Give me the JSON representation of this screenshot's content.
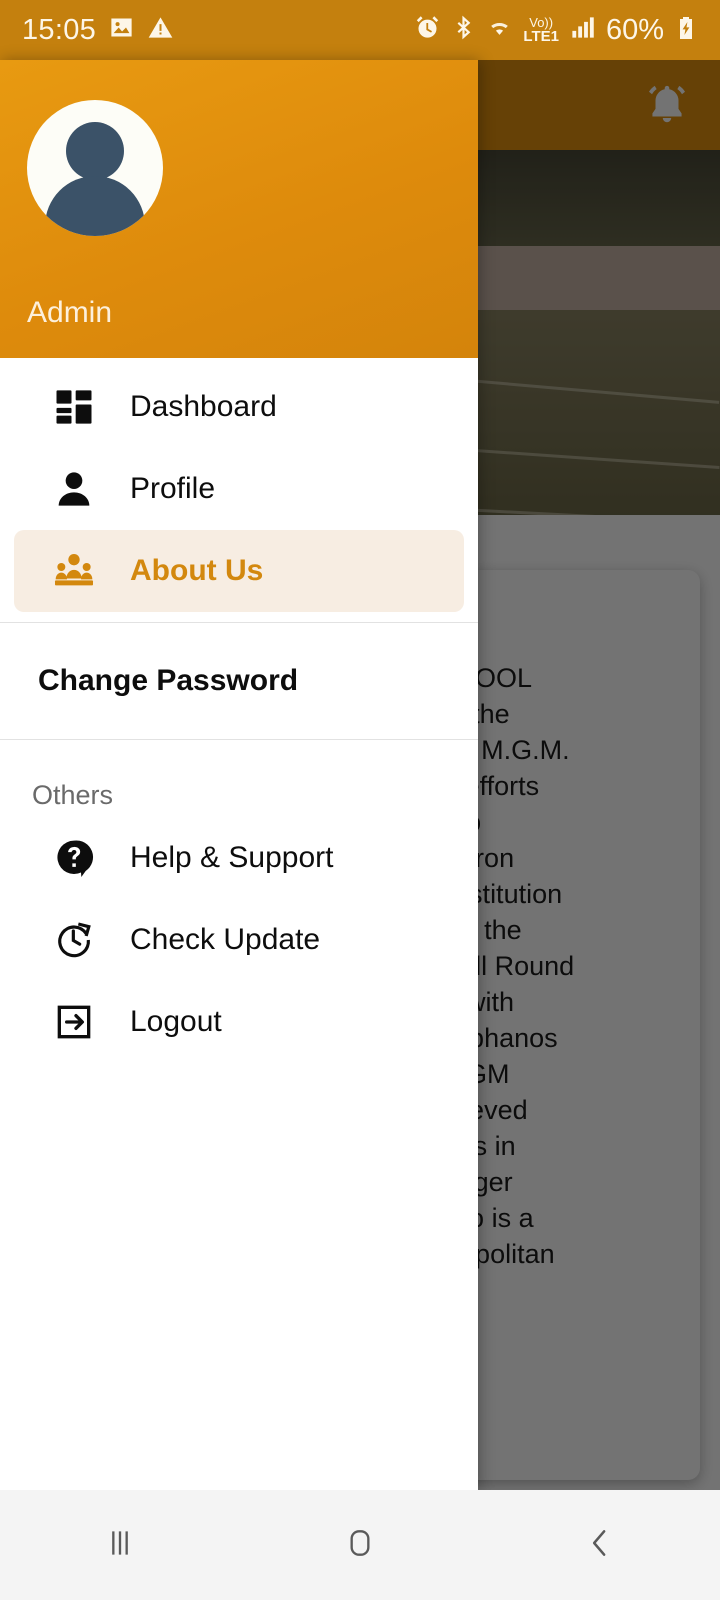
{
  "status_bar": {
    "time": "15:05",
    "battery_percent": "60%",
    "volte_top": "Vo))",
    "volte_bottom": "LTE1",
    "icons": [
      "gallery-icon",
      "warning-icon",
      "alarm-icon",
      "bluetooth-icon",
      "wifi-icon",
      "volte-icon",
      "signal-icon",
      "battery-charging-icon"
    ],
    "background_color": "#C4800E"
  },
  "app_bar": {
    "notification_icon": "bell-icon",
    "background_color": "#E2900F"
  },
  "drawer": {
    "username": "Admin",
    "header_color": "#DE8B0C",
    "accent_color": "#D3880E",
    "active_row_color": "#F7EDE2",
    "items": [
      {
        "label": "Dashboard",
        "icon": "dashboard-icon",
        "active": false
      },
      {
        "label": "Profile",
        "icon": "person-icon",
        "active": false
      },
      {
        "label": "About Us",
        "icon": "people-group-icon",
        "active": true
      }
    ],
    "change_password": "Change Password",
    "others_header": "Others",
    "others_items": [
      {
        "label": "Help & Support",
        "icon": "help-circle-icon"
      },
      {
        "label": "Check Update",
        "icon": "clock-refresh-icon"
      },
      {
        "label": "Logout",
        "icon": "logout-icon"
      }
    ]
  },
  "background_card": {
    "text": "                CHOOL\n            ed in the\n            of the M.G.M.\n            nual efforts\n            enario\n            ts Patron\n            his institution\n            3 with the\n            and All Round\n            nary with\n            r. Stephanos\n            he MGM\n            s believed\n            ogress in\n            manager\n            s, who is a\n            metropolitan\n            Indian"
  },
  "nav_bar": {
    "background_color": "#F4F4F4",
    "buttons": [
      {
        "name": "recents-button",
        "icon": "recents-icon"
      },
      {
        "name": "home-button",
        "icon": "home-icon"
      },
      {
        "name": "back-button",
        "icon": "back-chevron-icon"
      }
    ]
  }
}
